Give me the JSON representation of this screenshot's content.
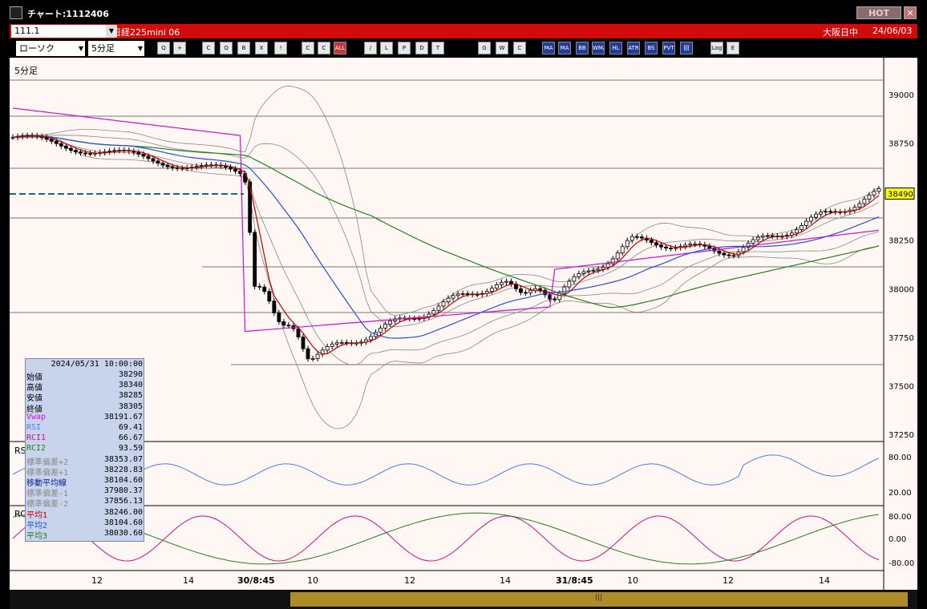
{
  "window": {
    "title": "チャート:1112406",
    "hot_label": "HOT",
    "close_label": "✕"
  },
  "infobar": {
    "code": "111.1",
    "instrument": "日経225mini 06",
    "market": "大阪日中",
    "date": "24/06/03"
  },
  "toolbar": {
    "chart_type": "ローソク",
    "interval": "5分足"
  },
  "toolbar_buttons": [
    {
      "name": "zoom-icon",
      "label": "Q"
    },
    {
      "name": "cursor-icon",
      "label": "+"
    },
    {
      "name": "candle-icon",
      "label": "C"
    },
    {
      "name": "search-icon",
      "label": "Q"
    },
    {
      "name": "bar-icon",
      "label": "B"
    },
    {
      "name": "cross-icon",
      "label": "X"
    },
    {
      "name": "info-icon",
      "label": "!"
    },
    {
      "name": "candle2-icon",
      "label": "C"
    },
    {
      "name": "candle3-icon",
      "label": "C"
    },
    {
      "name": "all-icon",
      "label": "ALL"
    },
    {
      "name": "pen-icon",
      "label": "/"
    },
    {
      "name": "link-icon",
      "label": "L"
    },
    {
      "name": "pointer-icon",
      "label": "P"
    },
    {
      "name": "doc-icon",
      "label": "D"
    },
    {
      "name": "trash-icon",
      "label": "T"
    },
    {
      "name": "grid-icon",
      "label": "G"
    },
    {
      "name": "wrench-icon",
      "label": "W"
    },
    {
      "name": "color-icon",
      "label": "C"
    },
    {
      "name": "ma-icon",
      "label": "MA"
    },
    {
      "name": "ma2-icon",
      "label": "MA"
    },
    {
      "name": "bb-icon",
      "label": "BB"
    },
    {
      "name": "wma-icon",
      "label": "WMA"
    },
    {
      "name": "hl-icon",
      "label": "HL"
    },
    {
      "name": "atr-icon",
      "label": "ATR"
    },
    {
      "name": "ichimoku-icon",
      "label": "BS"
    },
    {
      "name": "pvt-icon",
      "label": "PVT"
    },
    {
      "name": "window-icon",
      "label": "回"
    },
    {
      "name": "log-icon",
      "label": "Log"
    },
    {
      "name": "export-icon",
      "label": "E"
    }
  ],
  "panes": {
    "main_label": "5分足",
    "rsi_label": "RS",
    "rci_label": "RC"
  },
  "price_axis": [
    39000,
    38750,
    38500,
    38250,
    38000,
    37750,
    37500,
    37250
  ],
  "current_price": "38490",
  "rsi_axis": [
    "80.00",
    "20.00"
  ],
  "rci_axis": [
    "80.00",
    "0.00",
    "-80.00"
  ],
  "time_axis": [
    "12",
    "14",
    "30/8:45",
    "10",
    "12",
    "14",
    "31/8:45",
    "10",
    "12",
    "14"
  ],
  "infobox": {
    "datetime": "2024/05/31 10:00:00",
    "rows": [
      {
        "k": "始値",
        "v": "38290",
        "c": "#000"
      },
      {
        "k": "高値",
        "v": "38340",
        "c": "#000"
      },
      {
        "k": "安値",
        "v": "38285",
        "c": "#000"
      },
      {
        "k": "終値",
        "v": "38305",
        "c": "#000"
      },
      {
        "k": "Vwap",
        "v": "38191.67",
        "c": "#d010d0"
      },
      {
        "k": "RSI",
        "v": "69.41",
        "c": "#4a80e0"
      },
      {
        "k": "RCI1",
        "v": "66.67",
        "c": "#d01080"
      },
      {
        "k": "RCI2",
        "v": "93.59",
        "c": "#208020"
      },
      {
        "k": "標準偏差+2",
        "v": "38353.07",
        "c": "#888"
      },
      {
        "k": "標準偏差+1",
        "v": "38228.83",
        "c": "#888"
      },
      {
        "k": "移動平均線",
        "v": "38104.60",
        "c": "#102090"
      },
      {
        "k": "標準偏差-1",
        "v": "37980.37",
        "c": "#888"
      },
      {
        "k": "標準偏差-2",
        "v": "37856.13",
        "c": "#888"
      },
      {
        "k": "平均1",
        "v": "38246.00",
        "c": "#c00000"
      },
      {
        "k": "平均2",
        "v": "38104.60",
        "c": "#2050e0"
      },
      {
        "k": "平均3",
        "v": "38030.60",
        "c": "#208020"
      }
    ]
  },
  "colors": {
    "vwap": "#d010d0",
    "ma1": "#c00000",
    "ma2": "#2050e0",
    "ma3": "#208020",
    "bands": "#888888",
    "rsi": "#4a80e0",
    "rci1": "#d01080",
    "rci2": "#208020"
  }
}
